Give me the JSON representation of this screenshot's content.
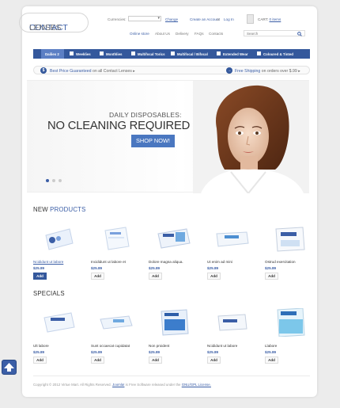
{
  "logo": {
    "part1": "CONTACT",
    "part2": "LENSES"
  },
  "header": {
    "currencies_label": "Currencies:",
    "change_link": "Change",
    "create_account": "Create an Account",
    "or": "or",
    "login": "Log In",
    "cart_label": "CART:",
    "cart_count": "0 items",
    "search_placeholder": "Search"
  },
  "topnav": [
    "Online store",
    "About Us",
    "Delivery",
    "FAQs",
    "Contacts"
  ],
  "menu": [
    "Dailies 2",
    "Weeklies",
    "Monthlies",
    "Multifocal Torics",
    "Multifocal / Bifocal",
    "Extended Wear",
    "Coloured & Tinted"
  ],
  "infobar": {
    "left_icon": "$",
    "left_highlight": "Best Price Guaranteed",
    "left_rest": "on all Contact Lenses",
    "right_icon": "→",
    "right_highlight": "Free Shipping",
    "right_rest": "on orders over $.99"
  },
  "hero": {
    "subtitle": "DAILY DISPOSABLES:",
    "title": "NO CLEANING REQUIRED",
    "button": "SHOP NOW!"
  },
  "new_products": {
    "title_a": "NEW",
    "title_b": "PRODUCTS",
    "items": [
      {
        "name": "Ncididunt ut labore",
        "price": "$25.89",
        "add": "Add"
      },
      {
        "name": "Incididunt ut labore et",
        "price": "$25.89",
        "add": "Add"
      },
      {
        "name": "Dolore magna aliqua.",
        "price": "$25.89",
        "add": "Add"
      },
      {
        "name": "Ut enim ad mini",
        "price": "$25.89",
        "add": "Add"
      },
      {
        "name": "Ostrud exercitation",
        "price": "$25.89",
        "add": "Add"
      }
    ]
  },
  "specials": {
    "title": "SPECIALS",
    "items": [
      {
        "name": "Ult labore",
        "price": "$25.89",
        "add": "Add"
      },
      {
        "name": "Sunt occaecat cupidatat",
        "price": "$25.89",
        "add": "Add"
      },
      {
        "name": "Non proident",
        "price": "$25.89",
        "add": "Add"
      },
      {
        "name": "Ncididunt ut labore",
        "price": "$25.89",
        "add": "Add"
      },
      {
        "name": "Llabore",
        "price": "$25.89",
        "add": "Add"
      }
    ]
  },
  "footer": {
    "text1": "Copyright © 2012 Virtue Mart. All Rights Reserved.",
    "joomla": "Joomla!",
    "text2": "is Free Software released under the",
    "license": "GNU/GPL License."
  },
  "colors": {
    "brand": "#34589c",
    "link": "#3b5ea6"
  }
}
